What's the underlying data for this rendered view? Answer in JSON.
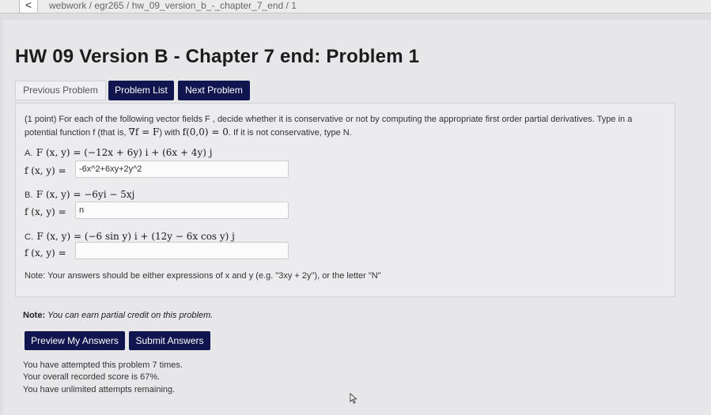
{
  "breadcrumb": {
    "back_label": "<",
    "path": "webwork / egr265 / hw_09_version_b_-_chapter_7_end / 1"
  },
  "page": {
    "title": "HW 09 Version B - Chapter 7 end: Problem 1"
  },
  "nav": {
    "previous_label": "Previous Problem",
    "list_label": "Problem List",
    "next_label": "Next Problem"
  },
  "problem": {
    "intro_line1": "(1 point) For each of the following vector fields F , decide whether it is conservative or not by computing the appropriate first order partial derivatives. Type in a",
    "intro_line2_a": "potential function f (that is, ",
    "intro_line2_math1": "∇f = F",
    "intro_line2_b": ") with ",
    "intro_line2_math2": "f(0,0) = 0",
    "intro_line2_c": ". If it is not conservative, type N.",
    "parts": [
      {
        "label": "A.",
        "field_expr": "F (x, y) = (−12x + 6y) i + (6x + 4y) j",
        "answer_prefix": "f (x, y) =",
        "answer_value": "-6x^2+6xy+2y^2"
      },
      {
        "label": "B.",
        "field_expr": "F (x, y) = −6yi − 5xj",
        "answer_prefix": "f (x, y) =",
        "answer_value": "n"
      },
      {
        "label": "C.",
        "field_expr": "F (x, y) = (−6 sin y) i + (12y − 6x cos y) j",
        "answer_prefix": "f (x, y) =",
        "answer_value": ""
      }
    ],
    "note": "Note: Your answers should be either expressions of x and y (e.g. \"3xy + 2y\"), or the letter \"N\""
  },
  "partial_credit": {
    "bold": "Note:",
    "italic": "You can earn partial credit on this problem."
  },
  "actions": {
    "preview_label": "Preview My Answers",
    "submit_label": "Submit Answers"
  },
  "status": {
    "attempts": "You have attempted this problem 7 times.",
    "score": "Your overall recorded score is 67%.",
    "remaining": "You have unlimited attempts remaining."
  }
}
